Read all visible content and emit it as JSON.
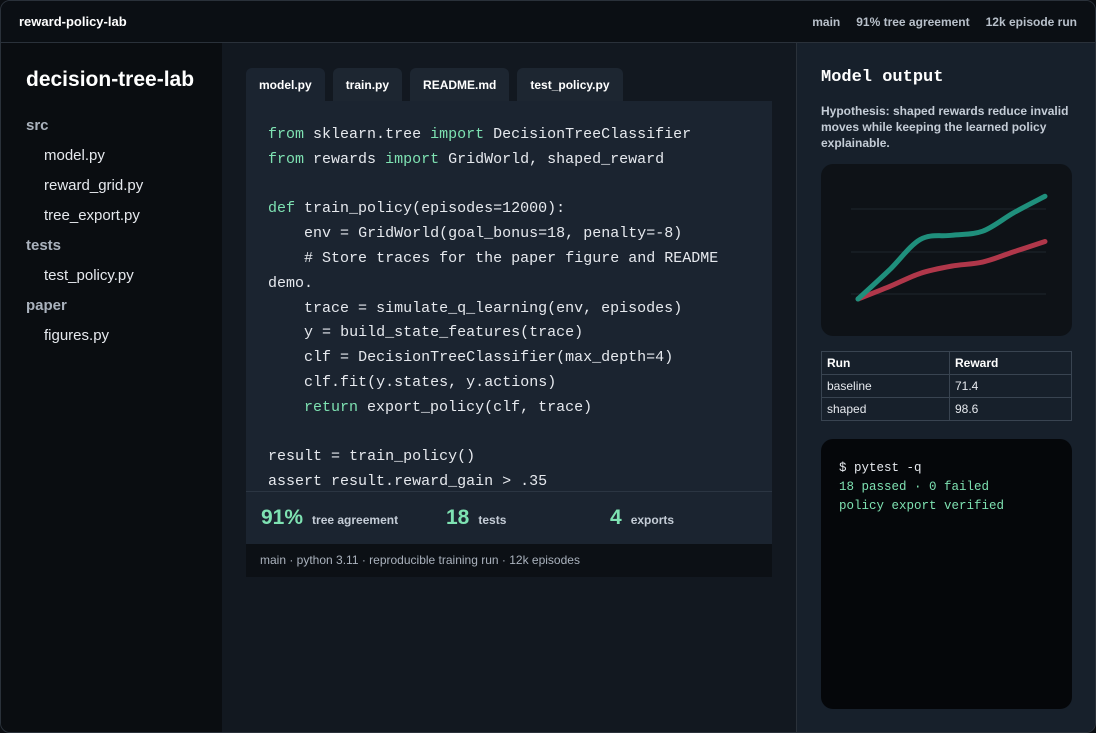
{
  "app": {
    "title": "reward-policy-lab",
    "status": [
      "main",
      "91% tree agreement",
      "12k episode run"
    ]
  },
  "sidebar": {
    "repo_name": "decision-tree-lab",
    "tree": [
      {
        "type": "folder",
        "label": "src"
      },
      {
        "type": "file",
        "label": "model.py"
      },
      {
        "type": "file",
        "label": "reward_grid.py"
      },
      {
        "type": "file",
        "label": "tree_export.py"
      },
      {
        "type": "folder",
        "label": "tests"
      },
      {
        "type": "file",
        "label": "test_policy.py"
      },
      {
        "type": "folder",
        "label": "paper"
      },
      {
        "type": "file",
        "label": "figures.py"
      }
    ]
  },
  "editor": {
    "tabs": [
      {
        "label": "model.py",
        "active": true
      },
      {
        "label": "train.py",
        "active": false
      },
      {
        "label": "README.md",
        "active": false
      },
      {
        "label": "test_policy.py",
        "active": false
      }
    ],
    "code_lines": [
      "from sklearn.tree import DecisionTreeClassifier",
      "from rewards import GridWorld, shaped_reward",
      "",
      "def train_policy(episodes=12000):",
      "    env = GridWorld(goal_bonus=18, penalty=-8)",
      "    # Store traces for the paper figure and README",
      "demo.",
      "    trace = simulate_q_learning(env, episodes)",
      "    y = build_state_features(trace)",
      "    clf = DecisionTreeClassifier(max_depth=4)",
      "    clf.fit(y.states, y.actions)",
      "    return export_policy(clf, trace)",
      "",
      "result = train_policy()",
      "assert result.reward_gain > .35"
    ],
    "keywords": [
      "from",
      "import",
      "def",
      "return"
    ]
  },
  "metrics": [
    {
      "value": "91%",
      "label": "tree agreement"
    },
    {
      "value": "18",
      "label": "tests"
    },
    {
      "value": "4",
      "label": "exports"
    }
  ],
  "footer": {
    "text": "main · python 3.11 · reproducible training run · 12k episodes"
  },
  "output_panel": {
    "title": "Model output",
    "hypothesis": "Hypothesis: shaped rewards reduce invalid moves while keeping the learned policy explainable.",
    "table": {
      "headers": [
        "Run",
        "Reward"
      ],
      "rows": [
        [
          "baseline",
          "71.4"
        ],
        [
          "shaped",
          "98.6"
        ]
      ]
    },
    "terminal_lines": [
      "$ pytest -q",
      "18 passed · 0 failed",
      "policy export verified"
    ]
  },
  "chart_data": {
    "type": "line",
    "grid": true,
    "legend": "none",
    "x": [
      0,
      1,
      2,
      3,
      4,
      5,
      6
    ],
    "series": [
      {
        "values": [
          0,
          28,
          58,
          62,
          66,
          84,
          100
        ],
        "color": "#1f8f7c"
      },
      {
        "values": [
          0,
          12,
          25,
          32,
          36,
          46,
          56
        ],
        "color": "#b0374a"
      }
    ],
    "ylim": [
      0,
      110
    ],
    "colors": {
      "accent": "#7ee2b2",
      "grid": "#1e252e"
    }
  }
}
